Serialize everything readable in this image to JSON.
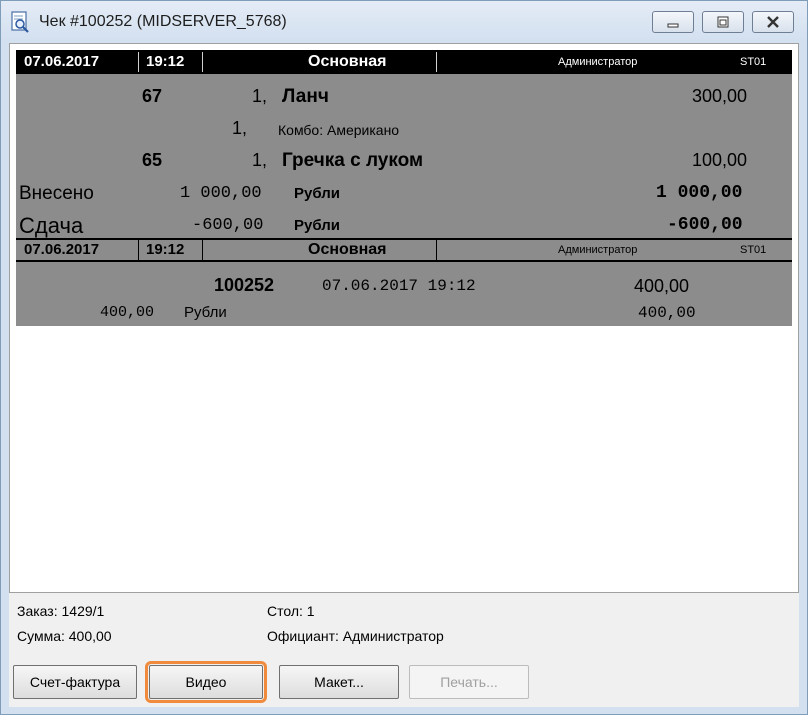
{
  "window": {
    "title": "Чек #100252 (MIDSERVER_5768)"
  },
  "receipt": {
    "header1": {
      "date": "07.06.2017",
      "time": "19:12",
      "name": "Основная",
      "user": "Администратор",
      "station": "ST01"
    },
    "items": [
      {
        "code": "67",
        "qty": "1,",
        "name": "Ланч",
        "price": "300,00"
      },
      {
        "qty": "1,",
        "name": "Комбо: Американо"
      },
      {
        "code": "65",
        "qty": "1,",
        "name": "Гречка с луком",
        "price": "100,00"
      }
    ],
    "paid": {
      "label": "Внесено",
      "amount": "1 000,00",
      "currency": "Рубли",
      "total": "1 000,00"
    },
    "change": {
      "label": "Сдача",
      "amount": "-600,00",
      "currency": "Рубли",
      "total": "-600,00"
    },
    "header2": {
      "date": "07.06.2017",
      "time": "19:12",
      "name": "Основная",
      "user": "Администратор",
      "station": "ST01"
    },
    "summary": {
      "number": "100252",
      "datetime": "07.06.2017 19:12",
      "sum": "400,00"
    },
    "summary2": {
      "amount": "400,00",
      "currency": "Рубли",
      "sum": "400,00"
    }
  },
  "info": {
    "order": "Заказ: 1429/1",
    "sum": "Сумма: 400,00",
    "table": "Стол: 1",
    "waiter": "Официант: Администратор"
  },
  "buttons": {
    "invoice": "Счет-фактура",
    "video": "Видео",
    "layout": "Макет...",
    "print": "Печать..."
  },
  "colors": {
    "highlight": "#f08a3c",
    "receipt_bg": "#8c8c8c"
  }
}
